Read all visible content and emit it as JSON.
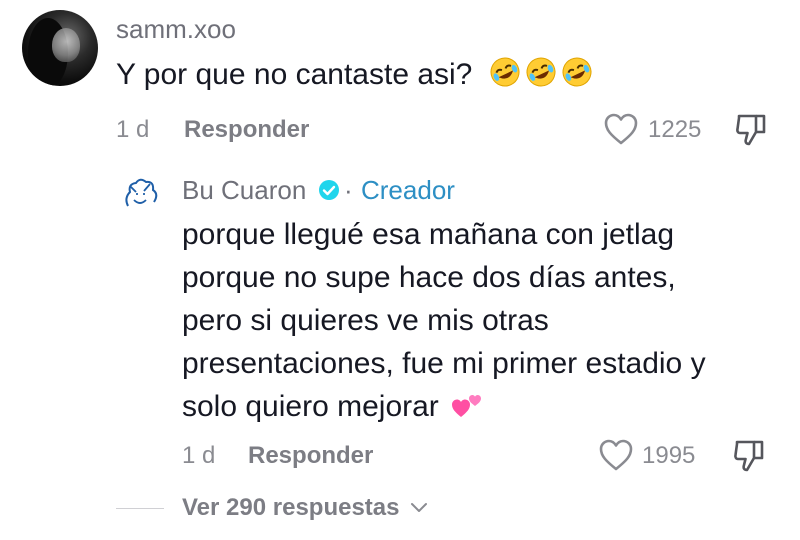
{
  "comment": {
    "username": "samm.xoo",
    "text": "Y por que no cantaste asi?",
    "emojis": [
      "rolling-on-floor-laughing-icon",
      "rolling-on-floor-laughing-icon",
      "rolling-on-floor-laughing-icon"
    ],
    "time": "1 d",
    "reply_label": "Responder",
    "likes": "1225"
  },
  "reply": {
    "username": "Bu Cuaron",
    "separator": "·",
    "creator_label": "Creador",
    "lines": [
      "porque llegué esa mañana con jetlag",
      "porque no supe hace dos días antes,",
      "pero si quieres ve mis otras",
      "presentaciones, fue mi primer estadio y",
      "solo quiero mejorar"
    ],
    "emoji": "two-hearts-icon",
    "time": "1 d",
    "reply_label": "Responder",
    "likes": "1995"
  },
  "thread": {
    "view_replies_label": "Ver 290 respuestas"
  },
  "colors": {
    "creator_blue": "#2d8fc4",
    "verified_blue": "#20d5ec",
    "gray_text": "#8a8b91"
  }
}
